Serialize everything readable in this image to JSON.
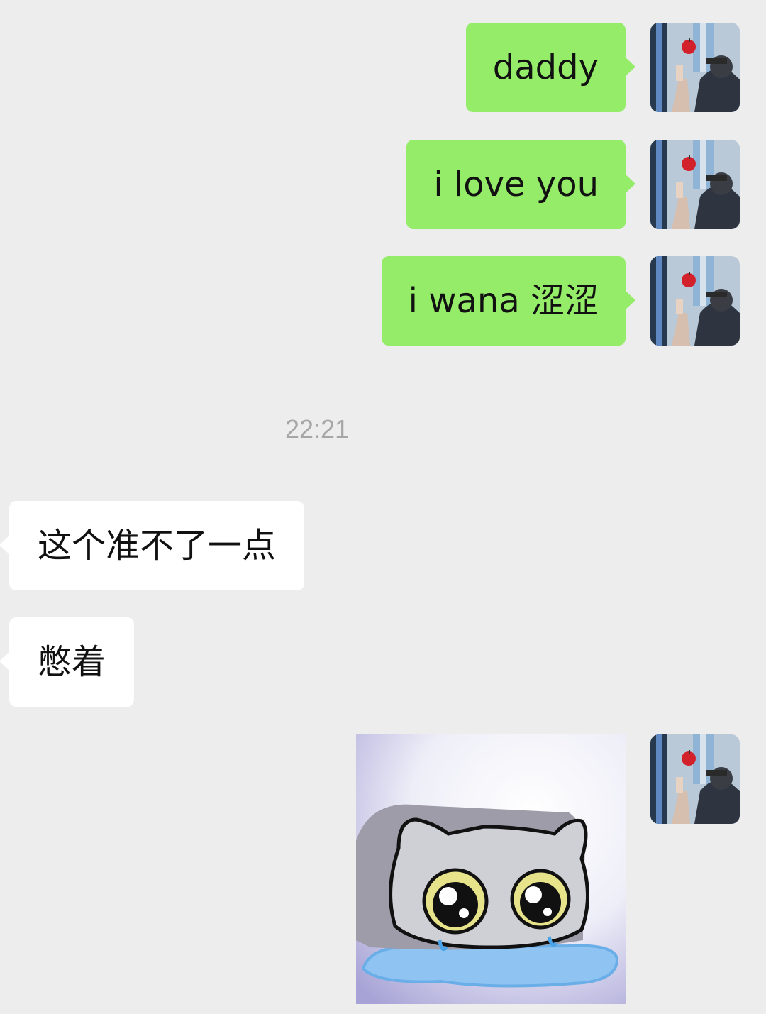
{
  "messages": [
    {
      "direction": "outgoing",
      "text": "daddy"
    },
    {
      "direction": "outgoing",
      "text": "i love you"
    },
    {
      "direction": "outgoing",
      "text": "i wana 涩涩"
    },
    {
      "direction": "incoming",
      "text": "这个准不了一点"
    },
    {
      "direction": "incoming",
      "text": "憋着"
    },
    {
      "direction": "outgoing",
      "type": "sticker",
      "sticker_icon": "crying-cat-sticker"
    }
  ],
  "timestamp": "22:21",
  "colors": {
    "background": "#ededed",
    "outgoing_bubble": "#95ec69",
    "incoming_bubble": "#ffffff",
    "timestamp_text": "#a6a6a6"
  },
  "avatar_icon": "user-avatar-photo"
}
